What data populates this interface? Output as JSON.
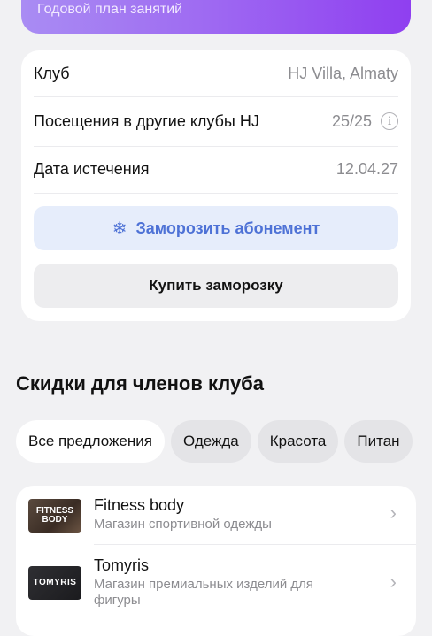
{
  "plan": {
    "subtitle": "Годовой план занятий"
  },
  "info": {
    "club_label": "Клуб",
    "club_value": "HJ Villa, Almaty",
    "visits_label": "Посещения в другие клубы HJ",
    "visits_value": "25/25",
    "expiry_label": "Дата истечения",
    "expiry_value": "12.04.27"
  },
  "actions": {
    "freeze_label": "Заморозить абонемент",
    "buy_freeze_label": "Купить заморозку"
  },
  "discounts": {
    "title": "Скидки для членов клуба",
    "chips": [
      "Все предложения",
      "Одежда",
      "Красота",
      "Питан"
    ],
    "offers": [
      {
        "name": "Fitness body",
        "description": "Магазин спортивной одежды",
        "logo_line1": "FITNESS",
        "logo_line2": "BODY"
      },
      {
        "name": "Tomyris",
        "description": "Магазин премиальных изделий для фигуры",
        "logo_text": "TOMYRIS"
      }
    ]
  },
  "colors": {
    "accent_blue": "#4e72d6",
    "banner_purple": "#9f6cf2"
  },
  "icons": {
    "info": "info-icon",
    "freeze": "snowflake-icon",
    "chevron": "chevron-right-icon"
  }
}
